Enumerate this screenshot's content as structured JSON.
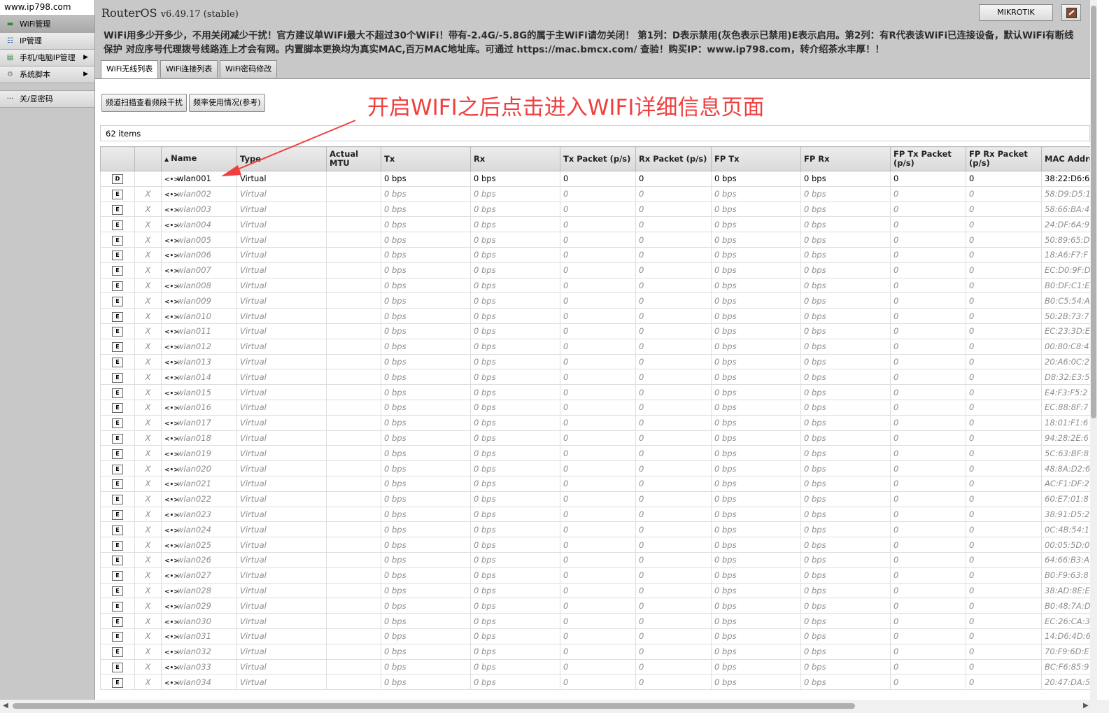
{
  "sidebar": {
    "site": "www.ip798.com",
    "items": [
      {
        "label": "WiFi管理",
        "icon": "wifi-icon",
        "active": true,
        "arrow": false
      },
      {
        "label": "IP管理",
        "icon": "ip-icon",
        "active": false,
        "arrow": false
      },
      {
        "label": "手机/电脑IP管理",
        "icon": "device-icon",
        "active": false,
        "arrow": true
      },
      {
        "label": "系统脚本",
        "icon": "script-icon",
        "active": false,
        "arrow": true
      }
    ],
    "extra_item": {
      "label": "关/显密码",
      "icon": "password-icon"
    }
  },
  "header": {
    "title": "RouterOS",
    "version": "v6.49.17 (stable)",
    "identity": "MIKROTIK",
    "notice": "WiFi用多少开多少，不用关闭减少干扰！官方建议单WiFi最大不超过30个WiFi！带有-2.4G/-5.8G的属于主WiFi请勿关闭！ 第1列：D表示禁用(灰色表示已禁用)E表示启用。第2列：有R代表该WiFi已连接设备，默认WiFi有断线保护 对应序号代理拨号线路连上才会有网。内置脚本更换均为真实MAC,百万MAC地址库。可通过 https://mac.bmcx.com/ 查验！购买IP：www.ip798.com，转介绍茶水丰厚！！"
  },
  "tabs": [
    "WiFi无线列表",
    "WiFi连接列表",
    "WiFi密码修改"
  ],
  "toolbar": {
    "scan_button": "频道扫描查看频段干扰",
    "usage_button": "频率使用情况(参考)"
  },
  "annotation": "开启WIFI之后点击进入WIFI详细信息页面",
  "items_count": "62 items",
  "colors": {
    "panel": "#c8c8c8",
    "annotation": "#ef4040"
  },
  "table": {
    "sort_indicator": "▲",
    "columns": [
      "",
      "",
      "Name",
      "Type",
      "Actual MTU",
      "Tx",
      "Rx",
      "Tx Packet (p/s)",
      "Rx Packet (p/s)",
      "FP Tx",
      "FP Rx",
      "FP Tx Packet (p/s)",
      "FP Rx Packet (p/s)",
      "MAC Address"
    ],
    "rows": [
      {
        "flag": "D",
        "status": "",
        "name": "wlan001",
        "type": "Virtual",
        "tx": "0 bps",
        "rx": "0 bps",
        "txp": "0",
        "rxp": "0",
        "fptx": "0 bps",
        "fprx": "0 bps",
        "fptxp": "0",
        "fprxp": "0",
        "mac": "38:22:D6:6",
        "disabled": false
      },
      {
        "flag": "E",
        "status": "X",
        "name": "wlan002",
        "type": "Virtual",
        "tx": "0 bps",
        "rx": "0 bps",
        "txp": "0",
        "rxp": "0",
        "fptx": "0 bps",
        "fprx": "0 bps",
        "fptxp": "0",
        "fprxp": "0",
        "mac": "58:D9:D5:1",
        "disabled": true
      },
      {
        "flag": "E",
        "status": "X",
        "name": "wlan003",
        "type": "Virtual",
        "tx": "0 bps",
        "rx": "0 bps",
        "txp": "0",
        "rxp": "0",
        "fptx": "0 bps",
        "fprx": "0 bps",
        "fptxp": "0",
        "fprxp": "0",
        "mac": "58:66:BA:4",
        "disabled": true
      },
      {
        "flag": "E",
        "status": "X",
        "name": "wlan004",
        "type": "Virtual",
        "tx": "0 bps",
        "rx": "0 bps",
        "txp": "0",
        "rxp": "0",
        "fptx": "0 bps",
        "fprx": "0 bps",
        "fptxp": "0",
        "fprxp": "0",
        "mac": "24:DF:6A:9",
        "disabled": true
      },
      {
        "flag": "E",
        "status": "X",
        "name": "wlan005",
        "type": "Virtual",
        "tx": "0 bps",
        "rx": "0 bps",
        "txp": "0",
        "rxp": "0",
        "fptx": "0 bps",
        "fprx": "0 bps",
        "fptxp": "0",
        "fprxp": "0",
        "mac": "50:89:65:D",
        "disabled": true
      },
      {
        "flag": "E",
        "status": "X",
        "name": "wlan006",
        "type": "Virtual",
        "tx": "0 bps",
        "rx": "0 bps",
        "txp": "0",
        "rxp": "0",
        "fptx": "0 bps",
        "fprx": "0 bps",
        "fptxp": "0",
        "fprxp": "0",
        "mac": "18:A6:F7:F",
        "disabled": true
      },
      {
        "flag": "E",
        "status": "X",
        "name": "wlan007",
        "type": "Virtual",
        "tx": "0 bps",
        "rx": "0 bps",
        "txp": "0",
        "rxp": "0",
        "fptx": "0 bps",
        "fprx": "0 bps",
        "fptxp": "0",
        "fprxp": "0",
        "mac": "EC:D0:9F:D",
        "disabled": true
      },
      {
        "flag": "E",
        "status": "X",
        "name": "wlan008",
        "type": "Virtual",
        "tx": "0 bps",
        "rx": "0 bps",
        "txp": "0",
        "rxp": "0",
        "fptx": "0 bps",
        "fprx": "0 bps",
        "fptxp": "0",
        "fprxp": "0",
        "mac": "B0:DF:C1:E",
        "disabled": true
      },
      {
        "flag": "E",
        "status": "X",
        "name": "wlan009",
        "type": "Virtual",
        "tx": "0 bps",
        "rx": "0 bps",
        "txp": "0",
        "rxp": "0",
        "fptx": "0 bps",
        "fprx": "0 bps",
        "fptxp": "0",
        "fprxp": "0",
        "mac": "B0:C5:54:A",
        "disabled": true
      },
      {
        "flag": "E",
        "status": "X",
        "name": "wlan010",
        "type": "Virtual",
        "tx": "0 bps",
        "rx": "0 bps",
        "txp": "0",
        "rxp": "0",
        "fptx": "0 bps",
        "fprx": "0 bps",
        "fptxp": "0",
        "fprxp": "0",
        "mac": "50:2B:73:7",
        "disabled": true
      },
      {
        "flag": "E",
        "status": "X",
        "name": "wlan011",
        "type": "Virtual",
        "tx": "0 bps",
        "rx": "0 bps",
        "txp": "0",
        "rxp": "0",
        "fptx": "0 bps",
        "fprx": "0 bps",
        "fptxp": "0",
        "fprxp": "0",
        "mac": "EC:23:3D:E",
        "disabled": true
      },
      {
        "flag": "E",
        "status": "X",
        "name": "wlan012",
        "type": "Virtual",
        "tx": "0 bps",
        "rx": "0 bps",
        "txp": "0",
        "rxp": "0",
        "fptx": "0 bps",
        "fprx": "0 bps",
        "fptxp": "0",
        "fprxp": "0",
        "mac": "00:80:C8:4",
        "disabled": true
      },
      {
        "flag": "E",
        "status": "X",
        "name": "wlan013",
        "type": "Virtual",
        "tx": "0 bps",
        "rx": "0 bps",
        "txp": "0",
        "rxp": "0",
        "fptx": "0 bps",
        "fprx": "0 bps",
        "fptxp": "0",
        "fprxp": "0",
        "mac": "20:A6:0C:2",
        "disabled": true
      },
      {
        "flag": "E",
        "status": "X",
        "name": "wlan014",
        "type": "Virtual",
        "tx": "0 bps",
        "rx": "0 bps",
        "txp": "0",
        "rxp": "0",
        "fptx": "0 bps",
        "fprx": "0 bps",
        "fptxp": "0",
        "fprxp": "0",
        "mac": "D8:32:E3:5",
        "disabled": true
      },
      {
        "flag": "E",
        "status": "X",
        "name": "wlan015",
        "type": "Virtual",
        "tx": "0 bps",
        "rx": "0 bps",
        "txp": "0",
        "rxp": "0",
        "fptx": "0 bps",
        "fprx": "0 bps",
        "fptxp": "0",
        "fprxp": "0",
        "mac": "E4:F3:F5:2",
        "disabled": true
      },
      {
        "flag": "E",
        "status": "X",
        "name": "wlan016",
        "type": "Virtual",
        "tx": "0 bps",
        "rx": "0 bps",
        "txp": "0",
        "rxp": "0",
        "fptx": "0 bps",
        "fprx": "0 bps",
        "fptxp": "0",
        "fprxp": "0",
        "mac": "EC:88:8F:7",
        "disabled": true
      },
      {
        "flag": "E",
        "status": "X",
        "name": "wlan017",
        "type": "Virtual",
        "tx": "0 bps",
        "rx": "0 bps",
        "txp": "0",
        "rxp": "0",
        "fptx": "0 bps",
        "fprx": "0 bps",
        "fptxp": "0",
        "fprxp": "0",
        "mac": "18:01:F1:6",
        "disabled": true
      },
      {
        "flag": "E",
        "status": "X",
        "name": "wlan018",
        "type": "Virtual",
        "tx": "0 bps",
        "rx": "0 bps",
        "txp": "0",
        "rxp": "0",
        "fptx": "0 bps",
        "fprx": "0 bps",
        "fptxp": "0",
        "fprxp": "0",
        "mac": "94:28:2E:6",
        "disabled": true
      },
      {
        "flag": "E",
        "status": "X",
        "name": "wlan019",
        "type": "Virtual",
        "tx": "0 bps",
        "rx": "0 bps",
        "txp": "0",
        "rxp": "0",
        "fptx": "0 bps",
        "fprx": "0 bps",
        "fptxp": "0",
        "fprxp": "0",
        "mac": "5C:63:BF:8",
        "disabled": true
      },
      {
        "flag": "E",
        "status": "X",
        "name": "wlan020",
        "type": "Virtual",
        "tx": "0 bps",
        "rx": "0 bps",
        "txp": "0",
        "rxp": "0",
        "fptx": "0 bps",
        "fprx": "0 bps",
        "fptxp": "0",
        "fprxp": "0",
        "mac": "48:8A:D2:6",
        "disabled": true
      },
      {
        "flag": "E",
        "status": "X",
        "name": "wlan021",
        "type": "Virtual",
        "tx": "0 bps",
        "rx": "0 bps",
        "txp": "0",
        "rxp": "0",
        "fptx": "0 bps",
        "fprx": "0 bps",
        "fptxp": "0",
        "fprxp": "0",
        "mac": "AC:F1:DF:2",
        "disabled": true
      },
      {
        "flag": "E",
        "status": "X",
        "name": "wlan022",
        "type": "Virtual",
        "tx": "0 bps",
        "rx": "0 bps",
        "txp": "0",
        "rxp": "0",
        "fptx": "0 bps",
        "fprx": "0 bps",
        "fptxp": "0",
        "fprxp": "0",
        "mac": "60:E7:01:8",
        "disabled": true
      },
      {
        "flag": "E",
        "status": "X",
        "name": "wlan023",
        "type": "Virtual",
        "tx": "0 bps",
        "rx": "0 bps",
        "txp": "0",
        "rxp": "0",
        "fptx": "0 bps",
        "fprx": "0 bps",
        "fptxp": "0",
        "fprxp": "0",
        "mac": "38:91:D5:2",
        "disabled": true
      },
      {
        "flag": "E",
        "status": "X",
        "name": "wlan024",
        "type": "Virtual",
        "tx": "0 bps",
        "rx": "0 bps",
        "txp": "0",
        "rxp": "0",
        "fptx": "0 bps",
        "fprx": "0 bps",
        "fptxp": "0",
        "fprxp": "0",
        "mac": "0C:4B:54:1",
        "disabled": true
      },
      {
        "flag": "E",
        "status": "X",
        "name": "wlan025",
        "type": "Virtual",
        "tx": "0 bps",
        "rx": "0 bps",
        "txp": "0",
        "rxp": "0",
        "fptx": "0 bps",
        "fprx": "0 bps",
        "fptxp": "0",
        "fprxp": "0",
        "mac": "00:05:5D:0",
        "disabled": true
      },
      {
        "flag": "E",
        "status": "X",
        "name": "wlan026",
        "type": "Virtual",
        "tx": "0 bps",
        "rx": "0 bps",
        "txp": "0",
        "rxp": "0",
        "fptx": "0 bps",
        "fprx": "0 bps",
        "fptxp": "0",
        "fprxp": "0",
        "mac": "64:66:B3:A",
        "disabled": true
      },
      {
        "flag": "E",
        "status": "X",
        "name": "wlan027",
        "type": "Virtual",
        "tx": "0 bps",
        "rx": "0 bps",
        "txp": "0",
        "rxp": "0",
        "fptx": "0 bps",
        "fprx": "0 bps",
        "fptxp": "0",
        "fprxp": "0",
        "mac": "B0:F9:63:8",
        "disabled": true
      },
      {
        "flag": "E",
        "status": "X",
        "name": "wlan028",
        "type": "Virtual",
        "tx": "0 bps",
        "rx": "0 bps",
        "txp": "0",
        "rxp": "0",
        "fptx": "0 bps",
        "fprx": "0 bps",
        "fptxp": "0",
        "fprxp": "0",
        "mac": "38:AD:8E:E",
        "disabled": true
      },
      {
        "flag": "E",
        "status": "X",
        "name": "wlan029",
        "type": "Virtual",
        "tx": "0 bps",
        "rx": "0 bps",
        "txp": "0",
        "rxp": "0",
        "fptx": "0 bps",
        "fprx": "0 bps",
        "fptxp": "0",
        "fprxp": "0",
        "mac": "B0:48:7A:D",
        "disabled": true
      },
      {
        "flag": "E",
        "status": "X",
        "name": "wlan030",
        "type": "Virtual",
        "tx": "0 bps",
        "rx": "0 bps",
        "txp": "0",
        "rxp": "0",
        "fptx": "0 bps",
        "fprx": "0 bps",
        "fptxp": "0",
        "fprxp": "0",
        "mac": "EC:26:CA:3",
        "disabled": true
      },
      {
        "flag": "E",
        "status": "X",
        "name": "wlan031",
        "type": "Virtual",
        "tx": "0 bps",
        "rx": "0 bps",
        "txp": "0",
        "rxp": "0",
        "fptx": "0 bps",
        "fprx": "0 bps",
        "fptxp": "0",
        "fprxp": "0",
        "mac": "14:D6:4D:6",
        "disabled": true
      },
      {
        "flag": "E",
        "status": "X",
        "name": "wlan032",
        "type": "Virtual",
        "tx": "0 bps",
        "rx": "0 bps",
        "txp": "0",
        "rxp": "0",
        "fptx": "0 bps",
        "fprx": "0 bps",
        "fptxp": "0",
        "fprxp": "0",
        "mac": "70:F9:6D:E",
        "disabled": true
      },
      {
        "flag": "E",
        "status": "X",
        "name": "wlan033",
        "type": "Virtual",
        "tx": "0 bps",
        "rx": "0 bps",
        "txp": "0",
        "rxp": "0",
        "fptx": "0 bps",
        "fprx": "0 bps",
        "fptxp": "0",
        "fprxp": "0",
        "mac": "BC:F6:85:9",
        "disabled": true
      },
      {
        "flag": "E",
        "status": "X",
        "name": "wlan034",
        "type": "Virtual",
        "tx": "0 bps",
        "rx": "0 bps",
        "txp": "0",
        "rxp": "0",
        "fptx": "0 bps",
        "fprx": "0 bps",
        "fptxp": "0",
        "fprxp": "0",
        "mac": "20:47:DA:5",
        "disabled": true
      }
    ]
  }
}
